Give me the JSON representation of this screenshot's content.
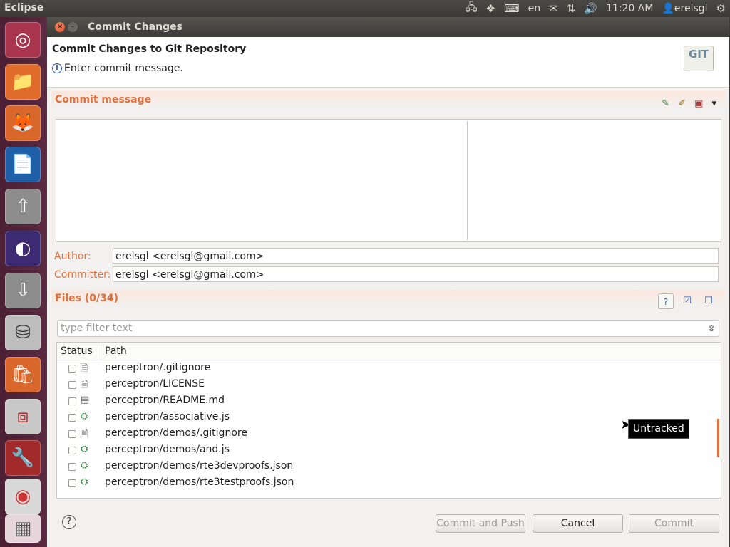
{
  "top_panel": {
    "app_name": "Eclipse",
    "keyboard": "en",
    "time": "11:20 AM",
    "user": "erelsgl"
  },
  "launcher": {
    "items": [
      "ubuntu-dash",
      "files",
      "firefox",
      "writer",
      "upload",
      "eclipse",
      "download",
      "disk",
      "software-center",
      "archive",
      "system-settings",
      "chrome",
      "workspaces"
    ]
  },
  "dialog": {
    "window_title": "Commit Changes",
    "header_title": "Commit Changes to Git Repository",
    "header_message": "Enter commit message.",
    "git_logo": "GIT",
    "commit_message_section": "Commit message",
    "commit_message_value": "",
    "author_label": "Author:",
    "author_value": "erelsgl <erelsgl@gmail.com>",
    "committer_label": "Committer:",
    "committer_value": "erelsgl <erelsgl@gmail.com>",
    "files_section": "Files (0/34)",
    "filter_placeholder": "type filter text",
    "columns": [
      "Status",
      "Path"
    ],
    "files": [
      {
        "path": "perceptron/.gitignore",
        "icon": "text-file-icon"
      },
      {
        "path": "perceptron/LICENSE",
        "icon": "text-file-icon"
      },
      {
        "path": "perceptron/README.md",
        "icon": "document-file-icon"
      },
      {
        "path": "perceptron/associative.js",
        "icon": "js-file-icon"
      },
      {
        "path": "perceptron/demos/.gitignore",
        "icon": "text-file-icon"
      },
      {
        "path": "perceptron/demos/and.js",
        "icon": "js-file-icon"
      },
      {
        "path": "perceptron/demos/rte3devproofs.json",
        "icon": "js-file-icon"
      },
      {
        "path": "perceptron/demos/rte3testproofs.json",
        "icon": "js-file-icon"
      }
    ],
    "tooltip": "Untracked",
    "buttons": {
      "commit_and_push": "Commit and Push",
      "cancel": "Cancel",
      "commit": "Commit"
    }
  }
}
